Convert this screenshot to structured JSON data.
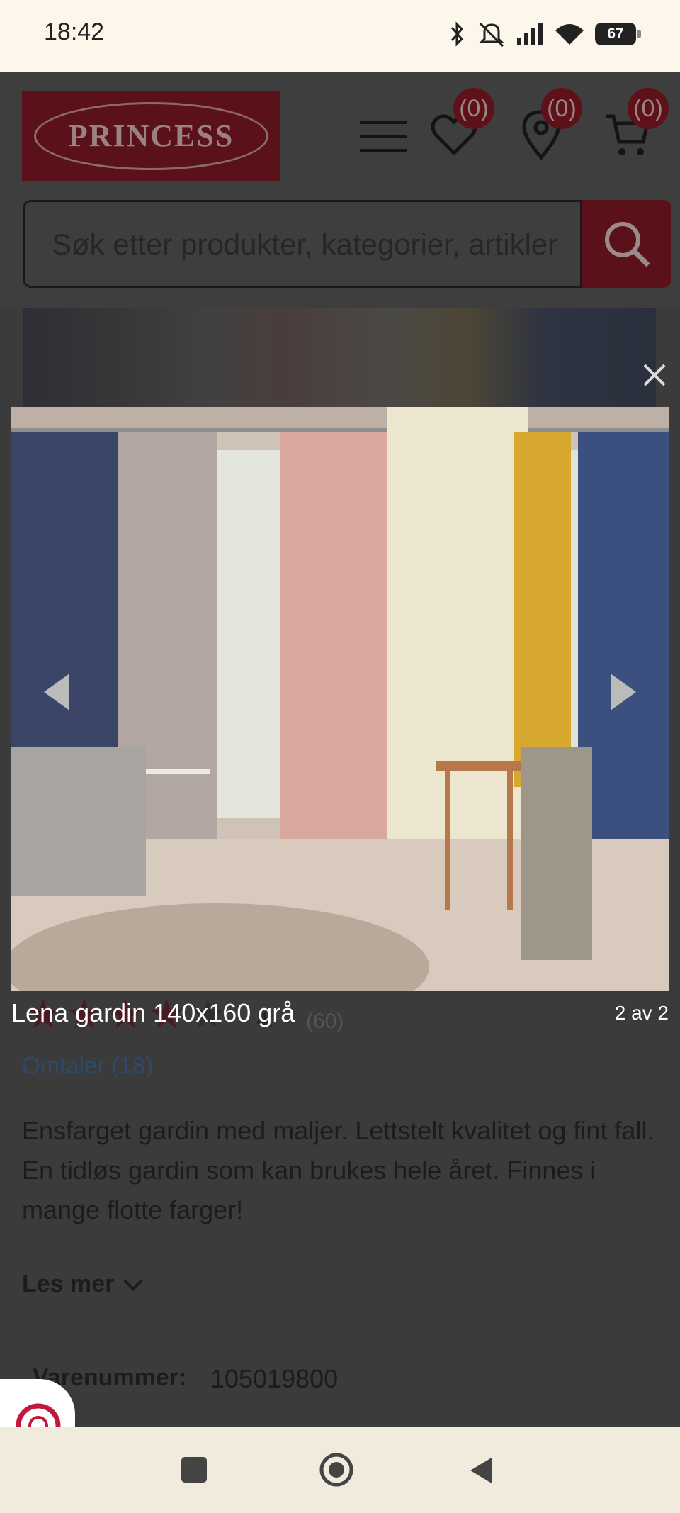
{
  "status_bar": {
    "time": "18:42",
    "battery": "67"
  },
  "header": {
    "logo_text": "PRINCESS",
    "wishlist_count": "(0)",
    "stores_count": "(0)",
    "cart_count": "(0)"
  },
  "search": {
    "placeholder": "Søk etter produkter, kategorier, artikler"
  },
  "product": {
    "rating": "4.",
    "rating_count": "(60)",
    "reviews_link": "Omtaler (18)",
    "description": "Ensfarget gardin med maljer. Lettstelt kvalitet og fint fall. En tidløs gardin som kan brukes hele året. Finnes i mange flotte farger!",
    "read_more": "Les mer",
    "sku_label": "Varenummer:",
    "sku_value": "105019800"
  },
  "lightbox": {
    "caption": "Lena gardin 140x160 grå",
    "counter": "2 av 2"
  },
  "colors": {
    "brand": "#9b1c2e",
    "overlay_bg": "#3b3b3b",
    "status_bg": "#fcf7ea"
  }
}
